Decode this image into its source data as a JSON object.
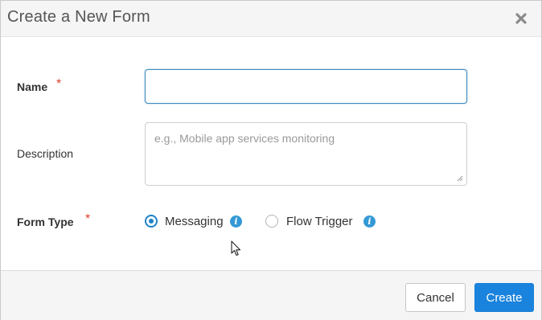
{
  "dialog": {
    "title": "Create a New Form"
  },
  "fields": {
    "name": {
      "label": "Name",
      "required_mark": "*",
      "value": ""
    },
    "description": {
      "label": "Description",
      "placeholder": "e.g., Mobile app services monitoring",
      "value": ""
    },
    "form_type": {
      "label": "Form Type",
      "required_mark": "*",
      "options": [
        {
          "label": "Messaging",
          "selected": true,
          "info_icon": "info-icon"
        },
        {
          "label": "Flow Trigger",
          "selected": false,
          "info_icon": "info-icon"
        }
      ]
    }
  },
  "footer": {
    "cancel_label": "Cancel",
    "create_label": "Create"
  },
  "colors": {
    "accent": "#1a83dd",
    "required": "#d9412f",
    "info": "#3399d6",
    "focus_border": "#3c8bbf"
  }
}
